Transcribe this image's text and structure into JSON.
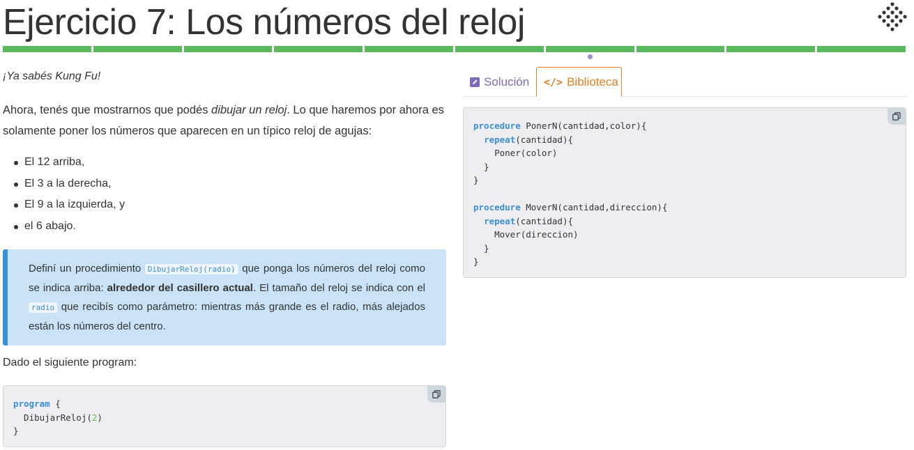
{
  "page": {
    "title": "Ejercicio 7: Los números del reloj"
  },
  "progress": {
    "segments": 10,
    "completed": 10,
    "current_index": 6,
    "color": "#5cb85c"
  },
  "statement": {
    "intro": "¡Ya sabés Kung Fu!",
    "main_before": "Ahora, tenés que mostrarnos que podés ",
    "main_em": "dibujar un reloj",
    "main_after": ". Lo que haremos por ahora es solamente poner los números que aparecen en un típico reloj de agujas:",
    "items": [
      "El 12 arriba,",
      "El 3 a la derecha,",
      "El 9 a la izquierda, y",
      "el 6 abajo."
    ]
  },
  "callout": {
    "t1": "Definí un procedimiento ",
    "code1": "DibujarReloj(radio)",
    "t2": " que ponga los números del reloj como se indica arriba: ",
    "bold": "alrededor del casillero actual",
    "t3": ". El tamaño del reloj se indica con el ",
    "code2": "radio",
    "t4": " que recibís como parámetro: mientras más grande es el radio, más alejados están los números del centro."
  },
  "program_intro": "Dado el siguiente program:",
  "program_code": {
    "kw_program": "program",
    "line1_rest": " {",
    "line2_a": "  DibujarReloj(",
    "line2_num": "2",
    "line2_b": ")",
    "line3": "}"
  },
  "tabs": {
    "solution": "Solución",
    "library": "Biblioteca",
    "library_icon": "</>"
  },
  "library_code": {
    "kw_procedure": "procedure",
    "kw_repeat": "repeat",
    "p1_sig": " PonerN(cantidad,color){",
    "p1_rep": "(cantidad){",
    "p1_body": "    Poner(color)",
    "close_inner": "  }",
    "close_outer": "}",
    "p2_sig": " MoverN(cantidad,direccion){",
    "p2_rep": "(cantidad){",
    "p2_body": "    Mover(direccion)"
  },
  "icons": {
    "logo": "mumuki-logo-icon",
    "copy": "copy-icon",
    "pencil": "pencil-square-icon",
    "code": "code-icon"
  },
  "colors": {
    "accent_blue": "#3a8fd8",
    "accent_orange": "#e67e22",
    "accent_purple": "#7c6ab8",
    "callout_bg": "#c9e2f5"
  }
}
